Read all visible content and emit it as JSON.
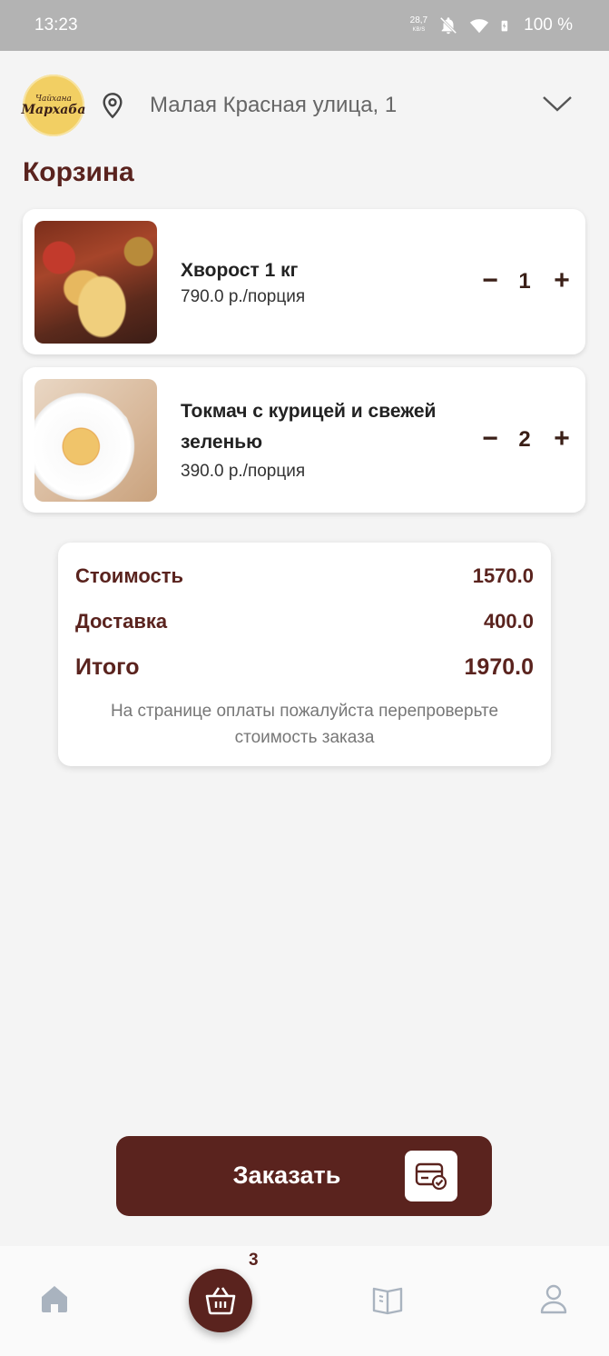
{
  "status_bar": {
    "time": "13:23",
    "speed_value": "28,7",
    "speed_unit": "KB/S",
    "battery": "100 %"
  },
  "header": {
    "logo_line1": "Чайхана",
    "logo_line2": "Мархаба",
    "address": "Малая Красная улица, 1"
  },
  "page": {
    "title": "Корзина"
  },
  "cart": {
    "items": [
      {
        "name": "Хворост 1 кг",
        "price": "790.0 р./порция",
        "quantity": "1",
        "image": "khvorost-photo"
      },
      {
        "name": "Токмач с курицей и свежей зеленью",
        "price": "390.0 р./порция",
        "quantity": "2",
        "image": "tokmach-photo"
      }
    ],
    "minus_symbol": "−",
    "plus_symbol": "+"
  },
  "summary": {
    "cost_label": "Стоимость",
    "cost_value": "1570.0",
    "delivery_label": "Доставка",
    "delivery_value": "400.0",
    "total_label": "Итого",
    "total_value": "1970.0",
    "note": "На странице оплаты пожалуйста перепроверьте стоимость заказа"
  },
  "order_button": {
    "label": "Заказать",
    "icon": "card-check-icon"
  },
  "bottom_nav": {
    "cart_badge": "3",
    "items": [
      "home-icon",
      "basket-icon",
      "menu-book-icon",
      "profile-icon"
    ]
  },
  "colors": {
    "brand": "#5a231e",
    "status_bar": "#b3b3b3",
    "background": "#f4f4f4"
  }
}
